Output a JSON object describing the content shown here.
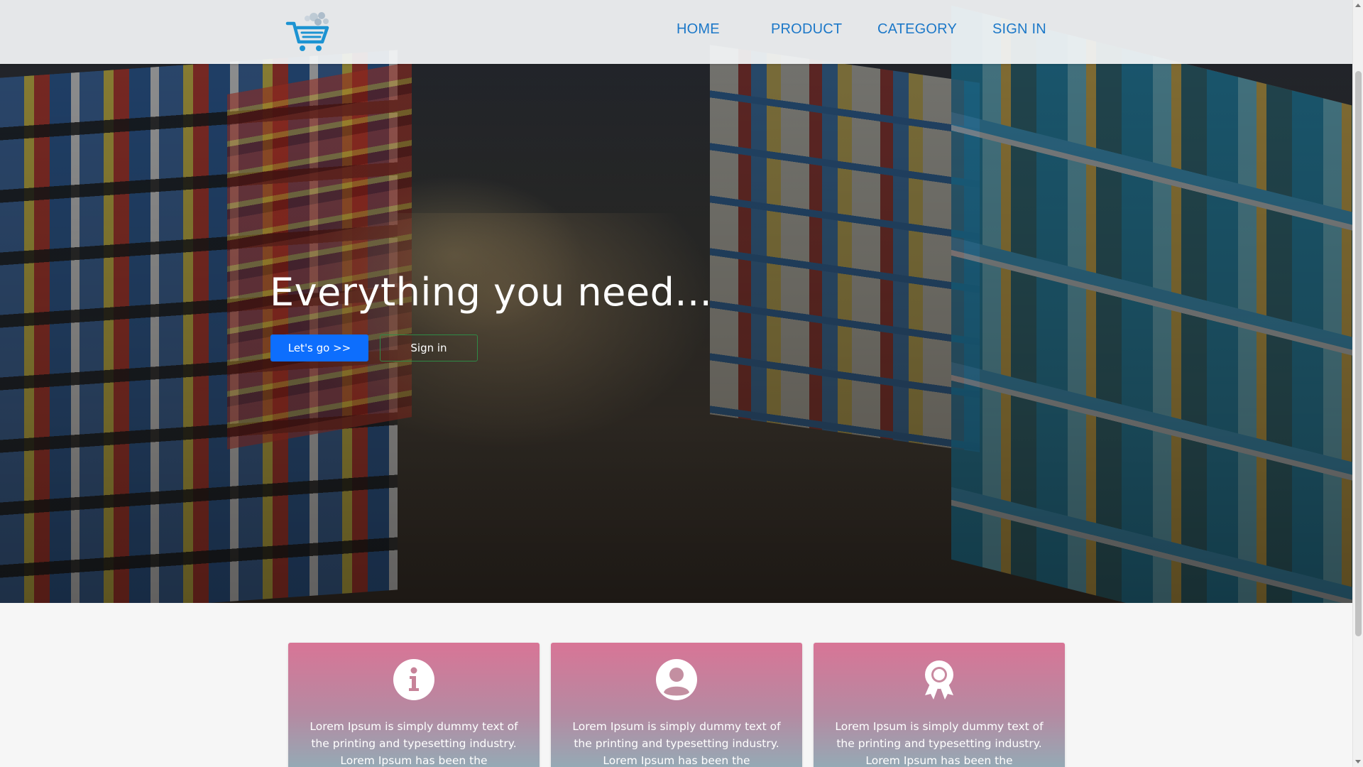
{
  "nav": {
    "logo_icon": "shopping-cart-icon",
    "links": [
      {
        "label": "HOME"
      },
      {
        "label": "PRODUCT"
      },
      {
        "label": "CATEGORY"
      },
      {
        "label": "SIGN IN"
      }
    ]
  },
  "hero": {
    "title": "Everything you need...",
    "primary_button": "Let's go >>",
    "secondary_button": "Sign in"
  },
  "cards": [
    {
      "icon": "info-icon",
      "text": "Lorem Ipsum is simply dummy text of the printing and typesetting industry. Lorem Ipsum has been the"
    },
    {
      "icon": "user-icon",
      "text": "Lorem Ipsum is simply dummy text of the printing and typesetting industry. Lorem Ipsum has been the"
    },
    {
      "icon": "award-icon",
      "text": "Lorem Ipsum is simply dummy text of the printing and typesetting industry. Lorem Ipsum has been the"
    }
  ],
  "colors": {
    "nav_link": "#1c78c8",
    "primary_button": "#0d6efd",
    "secondary_button_border": "#2f8a46",
    "card_gradient_top": "#d87596",
    "card_gradient_bottom": "#8ab4bb"
  }
}
